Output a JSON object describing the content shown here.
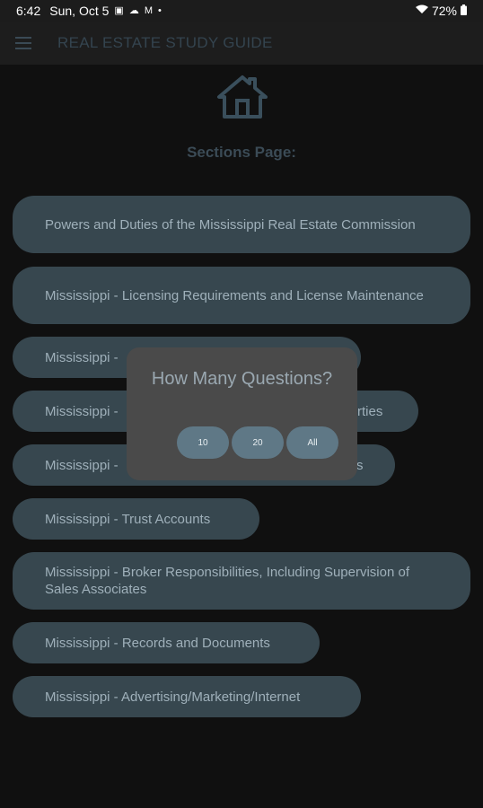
{
  "status_bar": {
    "time": "6:42",
    "date": "Sun, Oct 5",
    "left_icons": [
      "photo-icon",
      "cloud-icon",
      "gmail-icon",
      "dot-icon"
    ],
    "battery": "72%"
  },
  "app_bar": {
    "title": "REAL ESTATE STUDY GUIDE"
  },
  "page": {
    "heading": "Sections Page:"
  },
  "sections": [
    {
      "label": "Powers and Duties of the Mississippi Real Estate Commission"
    },
    {
      "label": "Mississippi - Licensing Requirements and License Maintenance"
    },
    {
      "label": "Mississippi - "
    },
    {
      "label": "Mississippi - ",
      "tail": "rties"
    },
    {
      "label": "Mississippi - ",
      "tail": "s"
    },
    {
      "label": "Mississippi - Trust Accounts"
    },
    {
      "label": "Mississippi - Broker Responsibilities, Including Supervision of Sales Associates"
    },
    {
      "label": "Mississippi - Records and Documents"
    },
    {
      "label": "Mississippi - Advertising/Marketing/Internet"
    }
  ],
  "dialog": {
    "title": "How Many Questions?",
    "options": [
      "10",
      "20",
      "All"
    ]
  },
  "colors": {
    "background": "#101010",
    "app_bar": "#1d1d1d",
    "section_button": "#37474f",
    "dialog": "#4a4a4a",
    "dialog_button": "#5f7886"
  }
}
